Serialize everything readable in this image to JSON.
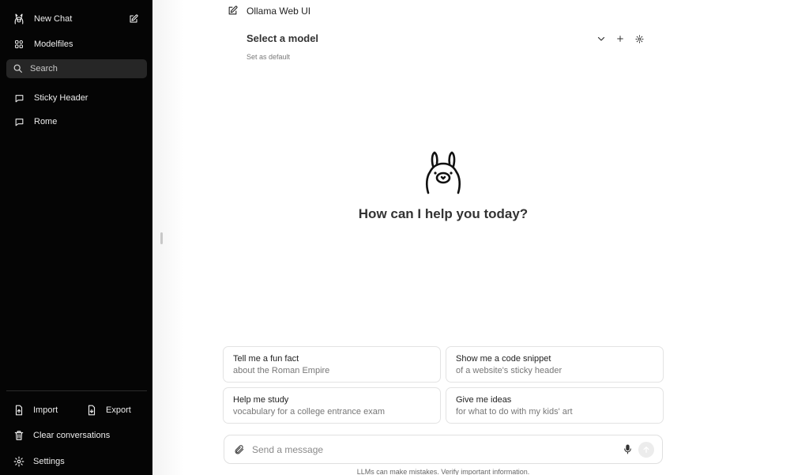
{
  "sidebar": {
    "new_chat_label": "New Chat",
    "modelfiles_label": "Modelfiles",
    "search_placeholder": "Search",
    "chats": [
      {
        "title": "Sticky Header"
      },
      {
        "title": "Rome"
      }
    ],
    "import_label": "Import",
    "export_label": "Export",
    "clear_label": "Clear conversations",
    "settings_label": "Settings"
  },
  "header": {
    "title": "Ollama Web UI"
  },
  "model": {
    "select_label": "Select a model",
    "set_default_label": "Set as default"
  },
  "main": {
    "greeting": "How can I help you today?"
  },
  "suggestions": [
    {
      "title": "Tell me a fun fact",
      "subtitle": "about the Roman Empire"
    },
    {
      "title": "Show me a code snippet",
      "subtitle": "of a website's sticky header"
    },
    {
      "title": "Help me study",
      "subtitle": "vocabulary for a college entrance exam"
    },
    {
      "title": "Give me ideas",
      "subtitle": "for what to do with my kids' art"
    }
  ],
  "composer": {
    "placeholder": "Send a message",
    "value": ""
  },
  "disclaimer": "LLMs can make mistakes. Verify important information.",
  "colors": {
    "sidebar_bg": "#050505",
    "search_bg": "#262626",
    "main_bg": "#ffffff"
  }
}
